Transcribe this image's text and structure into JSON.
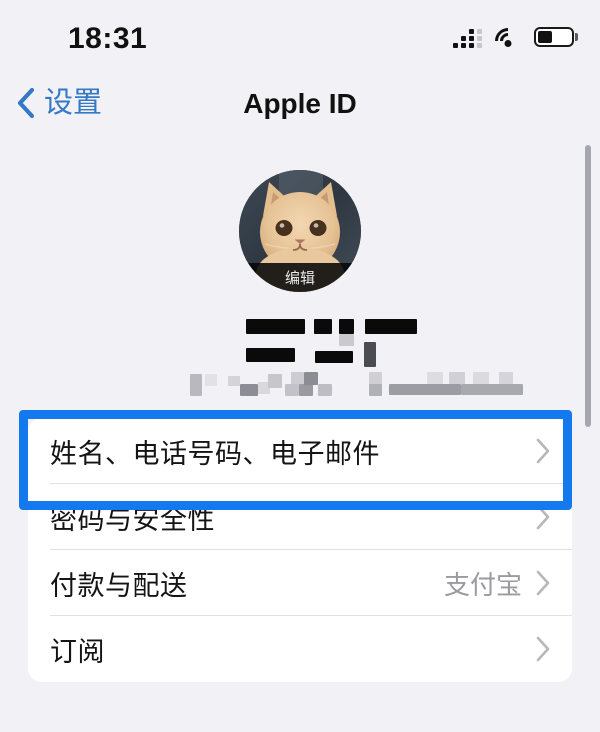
{
  "status_bar": {
    "time": "18:31",
    "signal_icon": "cellular-signal-icon",
    "wifi_icon": "wifi-icon",
    "battery_icon": "battery-icon",
    "battery_level_percent": 45
  },
  "nav_bar": {
    "back_icon": "chevron-left-icon",
    "back_label": "设置",
    "title": "Apple ID"
  },
  "profile": {
    "avatar_alt": "cat-photo",
    "edit_label": "编辑",
    "name_redacted": true,
    "email_redacted": true
  },
  "list": {
    "rows": [
      {
        "label": "姓名、电话号码、电子邮件",
        "value": "",
        "chevron": "chevron-right-icon",
        "highlighted": true
      },
      {
        "label": "密码与安全性",
        "value": "",
        "chevron": "chevron-right-icon",
        "highlighted": false
      },
      {
        "label": "付款与配送",
        "value": "支付宝",
        "chevron": "chevron-right-icon",
        "highlighted": false
      },
      {
        "label": "订阅",
        "value": "",
        "chevron": "chevron-right-icon",
        "highlighted": false
      }
    ]
  },
  "colors": {
    "background": "#F2F2F6",
    "card": "#FFFFFF",
    "accent_blue": "#3478C6",
    "highlight_blue": "#1479EE",
    "secondary_text": "#9A9AA0",
    "separator": "#E2E2E6"
  },
  "scrollbar": {
    "visible": true
  }
}
